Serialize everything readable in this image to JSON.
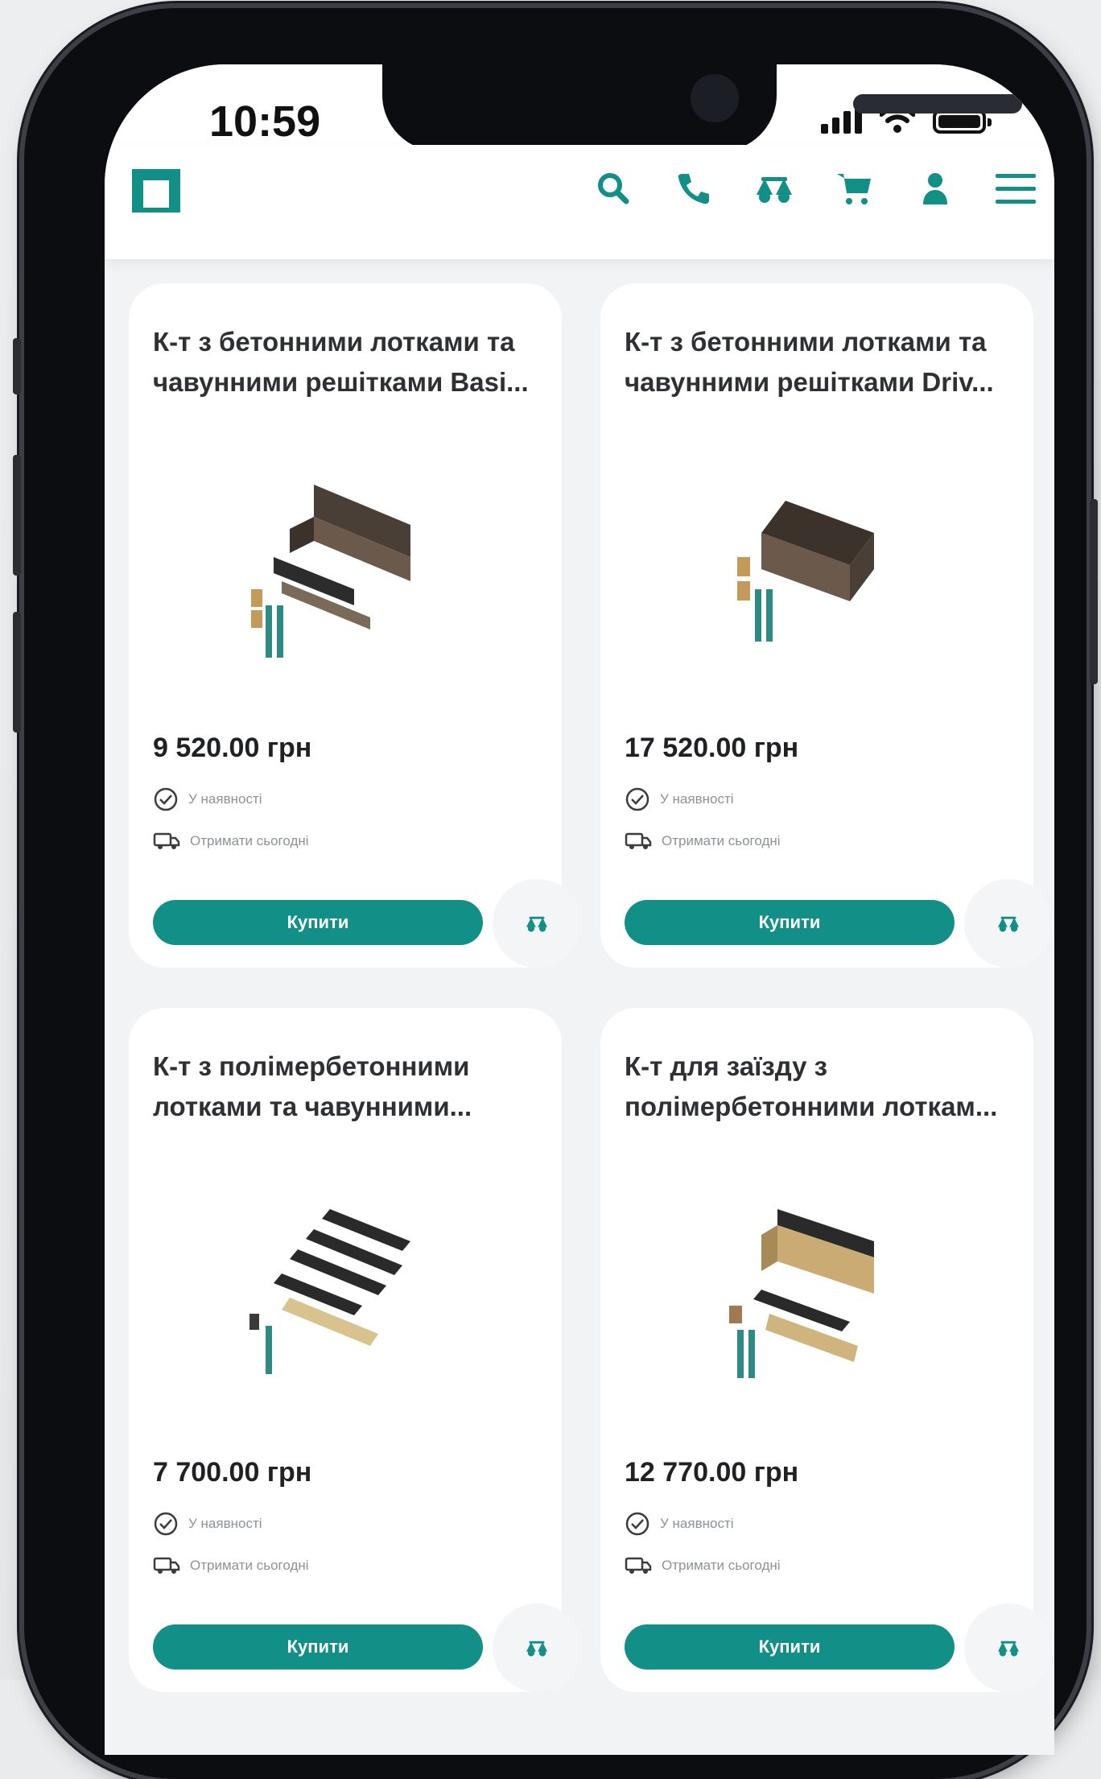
{
  "status_bar": {
    "time": "10:59"
  },
  "header": {
    "icons": [
      "search-icon",
      "phone-icon",
      "compare-scales-icon",
      "cart-icon",
      "user-icon",
      "menu-icon"
    ]
  },
  "colors": {
    "accent": "#128f86",
    "card_bg": "#ffffff",
    "page_bg": "#f1f3f4"
  },
  "products": [
    {
      "title": "К-т з бетонними лотками та чавунними решітками Basi...",
      "price": "9 520.00 грн",
      "stock": "У наявності",
      "delivery": "Отримати сьогодні",
      "buy_label": "Купити",
      "image": "dark-trays"
    },
    {
      "title": "К-т з бетонними лотками та чавунними решітками Driv...",
      "price": "17 520.00 грн",
      "stock": "У наявності",
      "delivery": "Отримати сьогодні",
      "buy_label": "Купити",
      "image": "dark-trays-stacked"
    },
    {
      "title": "К-т з полімербетонними лотками та чавунними...",
      "price": "7 700.00 грн",
      "stock": "У наявності",
      "delivery": "Отримати сьогодні",
      "buy_label": "Купити",
      "image": "sand-trays"
    },
    {
      "title": "К-т для заїзду з полімербетонними лоткам...",
      "price": "12 770.00 грн",
      "stock": "У наявності",
      "delivery": "Отримати сьогодні",
      "buy_label": "Купити",
      "image": "sand-trays-stacked"
    }
  ]
}
